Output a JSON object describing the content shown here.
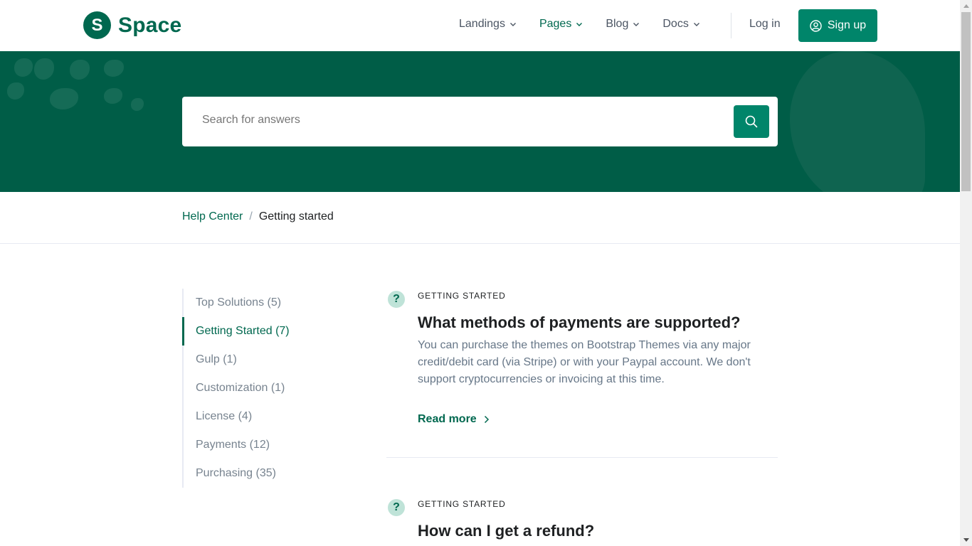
{
  "brand": {
    "logo_letter": "S",
    "name": "Space",
    "color": "#00684f"
  },
  "nav": {
    "items": [
      {
        "label": "Landings",
        "active": false
      },
      {
        "label": "Pages",
        "active": true
      },
      {
        "label": "Blog",
        "active": false
      },
      {
        "label": "Docs",
        "active": false
      }
    ],
    "login_label": "Log in",
    "signup_label": "Sign up"
  },
  "search": {
    "placeholder": "Search for answers",
    "button_icon": "search-icon"
  },
  "breadcrumb": {
    "parent": "Help Center",
    "separator": "/",
    "current": "Getting started"
  },
  "sidebar": {
    "items": [
      {
        "label": "Top Solutions (5)",
        "active": false
      },
      {
        "label": "Getting Started (7)",
        "active": true
      },
      {
        "label": "Gulp (1)",
        "active": false
      },
      {
        "label": "Customization (1)",
        "active": false
      },
      {
        "label": "License (4)",
        "active": false
      },
      {
        "label": "Payments (12)",
        "active": false
      },
      {
        "label": "Purchasing (35)",
        "active": false
      }
    ]
  },
  "articles": [
    {
      "category": "GETTING STARTED",
      "title": "What methods of payments are supported?",
      "body": "You can purchase the themes on Bootstrap Themes via any major credit/debit card (via Stripe) or with your Paypal account. We don't support cryptocurrencies or invoicing at this time.",
      "link_label": "Read more"
    },
    {
      "category": "GETTING STARTED",
      "title": "How can I get a refund?"
    }
  ],
  "colors": {
    "primary": "#00684f",
    "button": "#00856a",
    "hero_bg": "#005d47"
  }
}
